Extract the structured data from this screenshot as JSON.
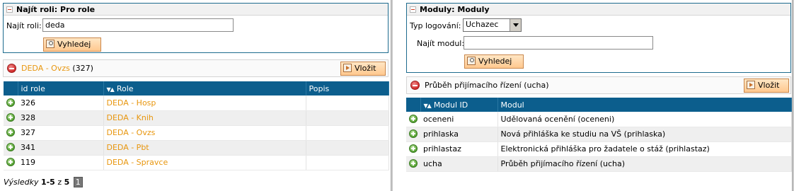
{
  "left": {
    "find_role": {
      "title": "Najít roli: Pro role",
      "label": "Najít roli:",
      "input_value": "deda",
      "search_button": "Vyhledej"
    },
    "selected": {
      "name": "DEDA - Ovzs",
      "count": "(327)",
      "insert_button": "Vložit"
    },
    "table": {
      "columns": [
        "id role",
        "Role",
        "Popis"
      ],
      "rows": [
        {
          "id": "326",
          "role": "DEDA - Hosp",
          "popis": ""
        },
        {
          "id": "328",
          "role": "DEDA - Knih",
          "popis": ""
        },
        {
          "id": "327",
          "role": "DEDA - Ovzs",
          "popis": ""
        },
        {
          "id": "341",
          "role": "DEDA - Pbt",
          "popis": ""
        },
        {
          "id": "119",
          "role": "DEDA - Spravce",
          "popis": ""
        }
      ]
    },
    "pager": {
      "prefix": "Výsledky",
      "range": "1-5",
      "of": "z",
      "total": "5",
      "page": "1"
    }
  },
  "right": {
    "modules": {
      "title": "Moduly: Moduly",
      "login_type_label": "Typ logování:",
      "login_type_value": "Uchazec",
      "find_module_label": "Najít modul:",
      "find_module_value": "",
      "search_button": "Vyhledej"
    },
    "selected": {
      "name": "Průběh přijímacího řízení (ucha)",
      "insert_button": "Vložit"
    },
    "table": {
      "columns": [
        "Modul ID",
        "Modul"
      ],
      "rows": [
        {
          "id": "oceneni",
          "modul": "Udělovaná ocenění (oceneni)"
        },
        {
          "id": "prihlaska",
          "modul": "Nová přihláška ke studiu na VŠ (prihlaska)"
        },
        {
          "id": "prihlastaz",
          "modul": "Elektronická přihláška pro žadatele o stáž (prihlastaz)"
        },
        {
          "id": "ucha",
          "modul": "Průběh přijímacího řízení (ucha)"
        }
      ]
    }
  },
  "colors": {
    "header_blue": "#0c5e8d",
    "link_orange": "#e8960e",
    "button_orange": "#ffc88e"
  }
}
